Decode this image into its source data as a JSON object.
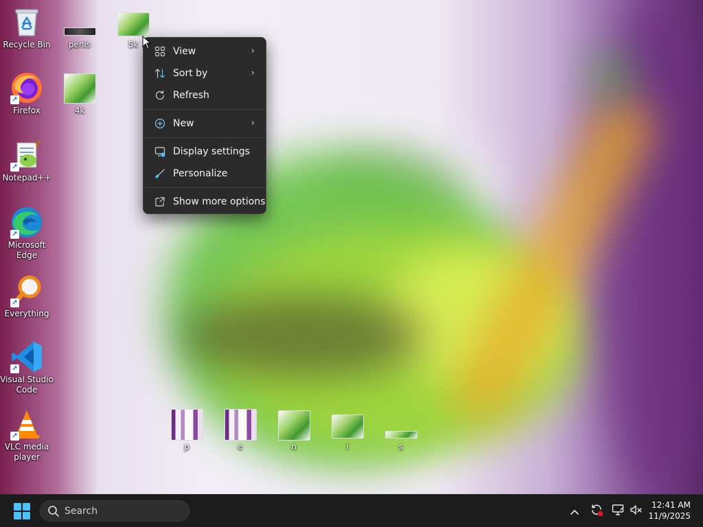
{
  "desktop": {
    "icons": [
      {
        "label": "Recycle Bin",
        "icon": "recycle-bin-icon"
      },
      {
        "label": "penis",
        "icon": "image-file-icon"
      },
      {
        "label": "5k",
        "icon": "image-file-icon"
      },
      {
        "label": "Firefox",
        "icon": "firefox-icon"
      },
      {
        "label": "4k",
        "icon": "image-file-icon"
      },
      {
        "label": "Notepad++",
        "icon": "notepadplusplus-icon"
      },
      {
        "label": "Microsoft Edge",
        "icon": "edge-icon"
      },
      {
        "label": "Everything",
        "icon": "everything-search-icon"
      },
      {
        "label": "Visual Studio Code",
        "icon": "vscode-icon"
      },
      {
        "label": "VLC media player",
        "icon": "vlc-icon"
      },
      {
        "label": "p",
        "icon": "image-file-icon"
      },
      {
        "label": "e",
        "icon": "image-file-icon"
      },
      {
        "label": "n",
        "icon": "image-file-icon"
      },
      {
        "label": "i",
        "icon": "image-file-icon"
      },
      {
        "label": "s",
        "icon": "image-file-icon"
      }
    ]
  },
  "context_menu": {
    "items": [
      {
        "label": "View",
        "icon": "grid-view-icon",
        "submenu": true
      },
      {
        "label": "Sort by",
        "icon": "sort-icon",
        "submenu": true
      },
      {
        "label": "Refresh",
        "icon": "refresh-icon",
        "submenu": false
      },
      {
        "label": "New",
        "icon": "add-circle-icon",
        "submenu": true
      },
      {
        "label": "Display settings",
        "icon": "display-settings-icon",
        "submenu": false
      },
      {
        "label": "Personalize",
        "icon": "brush-icon",
        "submenu": false
      },
      {
        "label": "Show more options",
        "icon": "open-external-icon",
        "submenu": false
      }
    ]
  },
  "taskbar": {
    "search_label": "Search",
    "clock_time": "12:41 AM",
    "clock_date": "11/9/2025",
    "tray_icons": [
      "chevron-up-icon",
      "sync-icon",
      "network-icon",
      "volume-muted-icon"
    ]
  },
  "colors": {
    "accent": "#4cc2ff",
    "menu_bg": "#2b2b2b",
    "taskbar_bg": "#1c1c1c"
  }
}
